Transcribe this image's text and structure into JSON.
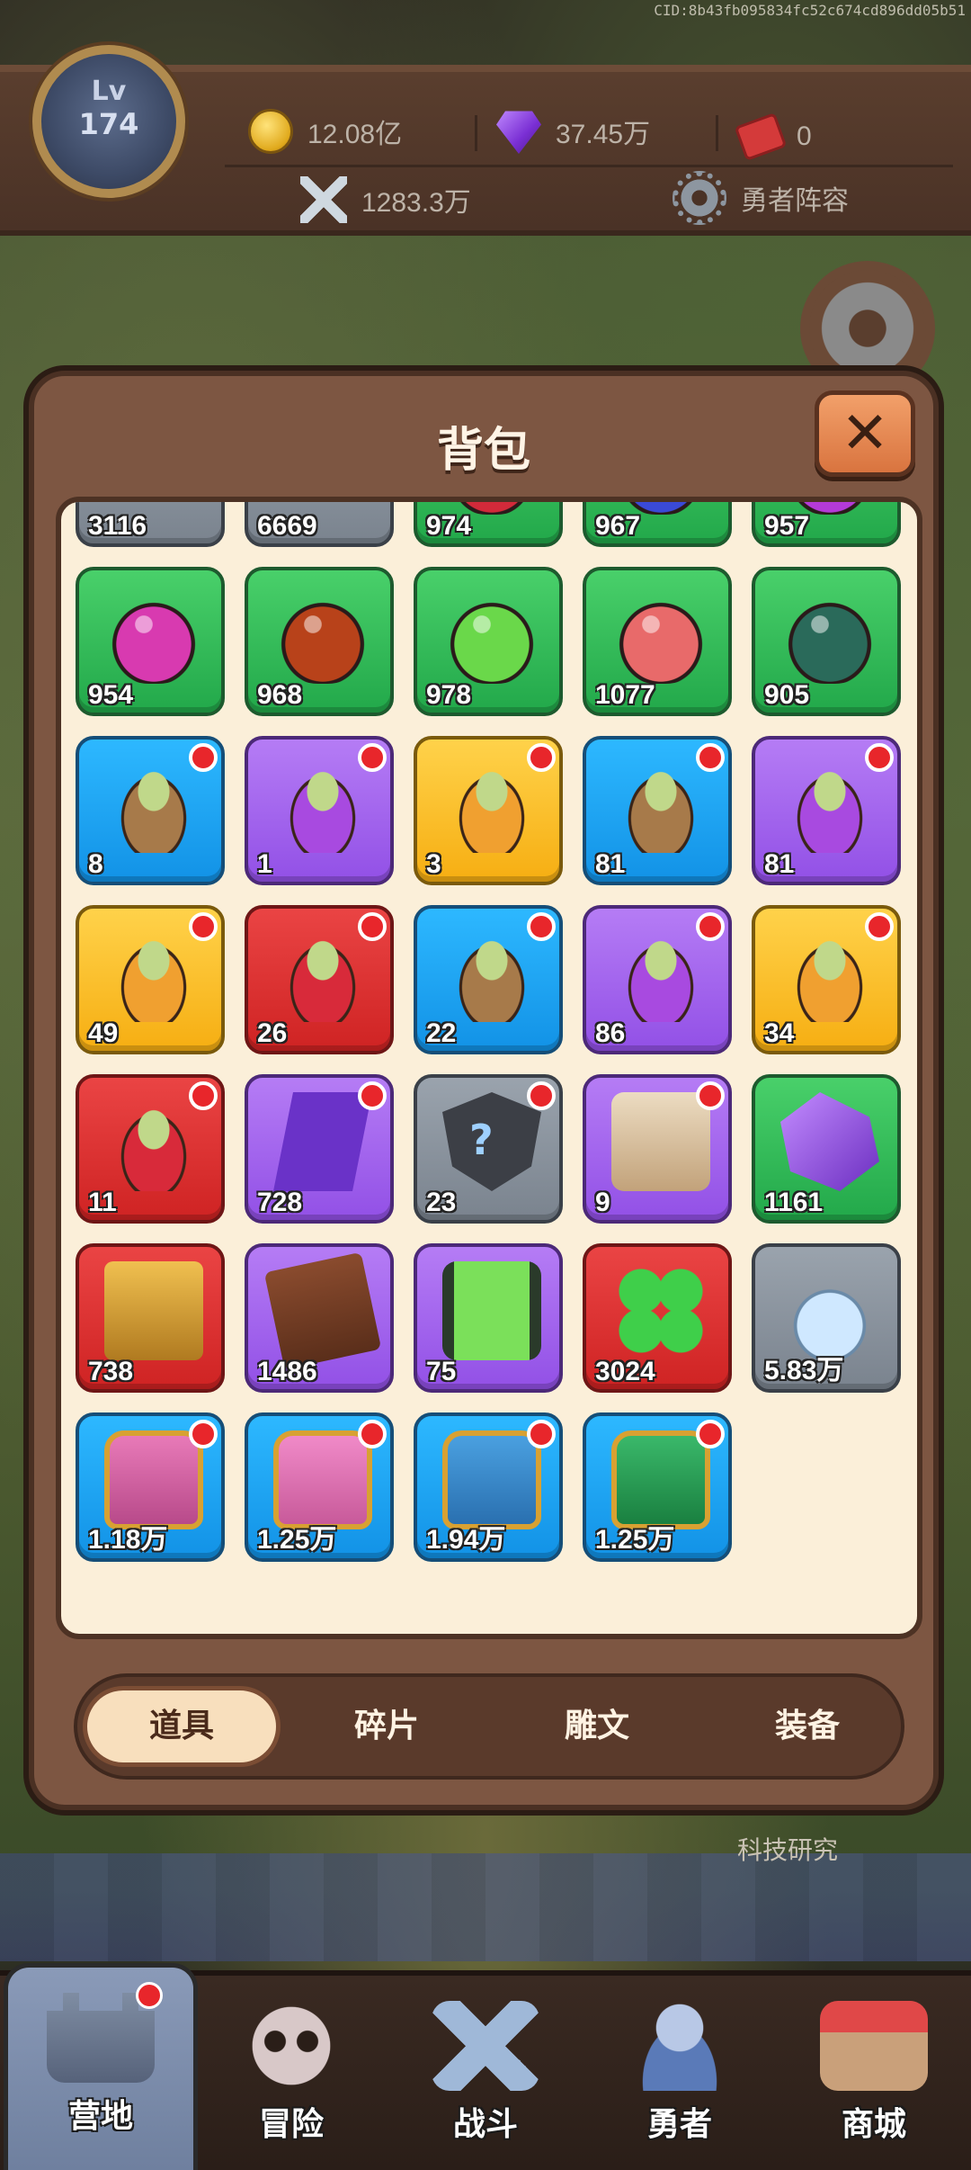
{
  "watermark": "CID:8b43fb095834fc52c674cd896dd05b51",
  "player": {
    "level_label": "Lv",
    "level": "174"
  },
  "currencies": {
    "gold": "12.08亿",
    "gems": "37.45万",
    "tickets": "0",
    "power": "1283.3万",
    "lineup_label": "勇者阵容"
  },
  "scene": {
    "research_label": "科技研究"
  },
  "bag": {
    "title": "背包",
    "close_symbol": "✕",
    "items": [
      {
        "qty": "3116",
        "color": "gray",
        "art": "herb",
        "new": false
      },
      {
        "qty": "6669",
        "color": "gray",
        "art": "herb",
        "new": false
      },
      {
        "qty": "974",
        "color": "green",
        "art": "potion",
        "tint": "#d22a3a",
        "new": false
      },
      {
        "qty": "967",
        "color": "green",
        "art": "potion",
        "tint": "#3a4ad8",
        "new": false
      },
      {
        "qty": "957",
        "color": "green",
        "art": "potion",
        "tint": "#b43ad8",
        "new": false
      },
      {
        "qty": "954",
        "color": "green",
        "art": "potion",
        "tint": "#d83ab0",
        "new": false
      },
      {
        "qty": "968",
        "color": "green",
        "art": "potion",
        "tint": "#b8421a",
        "new": false
      },
      {
        "qty": "978",
        "color": "green",
        "art": "potion",
        "tint": "#6ad84a",
        "new": false
      },
      {
        "qty": "1077",
        "color": "green",
        "art": "potion",
        "tint": "#e86a6a",
        "new": false
      },
      {
        "qty": "905",
        "color": "green",
        "art": "potion",
        "tint": "#2a6a5a",
        "new": false
      },
      {
        "qty": "8",
        "color": "blue",
        "art": "bag",
        "tint": "#a77a4a",
        "new": true
      },
      {
        "qty": "1",
        "color": "purple",
        "art": "bag",
        "tint": "#a84ae0",
        "new": true
      },
      {
        "qty": "3",
        "color": "gold",
        "art": "bag",
        "tint": "#f0a030",
        "new": true
      },
      {
        "qty": "81",
        "color": "blue",
        "art": "bag",
        "tint": "#a77a4a",
        "new": true
      },
      {
        "qty": "81",
        "color": "purple",
        "art": "bag",
        "tint": "#a84ae0",
        "new": true
      },
      {
        "qty": "49",
        "color": "gold",
        "art": "bag",
        "tint": "#f0a030",
        "new": true
      },
      {
        "qty": "26",
        "color": "red",
        "art": "bag",
        "tint": "#d82a3a",
        "new": true
      },
      {
        "qty": "22",
        "color": "blue",
        "art": "bag",
        "tint": "#a77a4a",
        "new": true
      },
      {
        "qty": "86",
        "color": "purple",
        "art": "bag",
        "tint": "#a84ae0",
        "new": true
      },
      {
        "qty": "34",
        "color": "gold",
        "art": "bag",
        "tint": "#f0a030",
        "new": true
      },
      {
        "qty": "11",
        "color": "red",
        "art": "bag",
        "tint": "#d82a3a",
        "new": true
      },
      {
        "qty": "728",
        "color": "purple",
        "art": "fragment",
        "new": true
      },
      {
        "qty": "23",
        "color": "gray",
        "art": "shield",
        "new": true
      },
      {
        "qty": "9",
        "color": "purple",
        "art": "mystery",
        "new": true
      },
      {
        "qty": "1161",
        "color": "green",
        "art": "crystal",
        "new": false
      },
      {
        "qty": "738",
        "color": "red",
        "art": "blockchest",
        "new": false
      },
      {
        "qty": "1486",
        "color": "purple",
        "art": "book",
        "new": false
      },
      {
        "qty": "75",
        "color": "purple",
        "art": "canister",
        "new": false
      },
      {
        "qty": "3024",
        "color": "red",
        "art": "clover",
        "new": false
      },
      {
        "qty": "5.83万",
        "color": "gray",
        "art": "bottle",
        "new": false
      },
      {
        "qty": "1.18万",
        "color": "blue",
        "art": "chest",
        "tint": "#e87ab8",
        "tint2": "#b84a8a",
        "new": true
      },
      {
        "qty": "1.25万",
        "color": "blue",
        "art": "chest",
        "tint": "#f08ac8",
        "tint2": "#c85a9a",
        "new": true
      },
      {
        "qty": "1.94万",
        "color": "blue",
        "art": "chest",
        "tint": "#4aa0e0",
        "tint2": "#2a70b0",
        "new": true
      },
      {
        "qty": "1.25万",
        "color": "blue",
        "art": "chest",
        "tint": "#3ab86a",
        "tint2": "#1a8040",
        "new": true
      }
    ],
    "tabs": [
      {
        "label": "道具",
        "active": true
      },
      {
        "label": "碎片",
        "active": false
      },
      {
        "label": "雕文",
        "active": false
      },
      {
        "label": "装备",
        "active": false
      }
    ]
  },
  "bottom_nav": [
    {
      "label": "营地",
      "icon": "castle-icon",
      "active": true,
      "badge": true
    },
    {
      "label": "冒险",
      "icon": "skull-icon",
      "active": false,
      "badge": false
    },
    {
      "label": "战斗",
      "icon": "swords-icon",
      "active": false,
      "badge": false
    },
    {
      "label": "勇者",
      "icon": "hero-icon",
      "active": false,
      "badge": false
    },
    {
      "label": "商城",
      "icon": "shop-icon",
      "active": false,
      "badge": false
    }
  ]
}
